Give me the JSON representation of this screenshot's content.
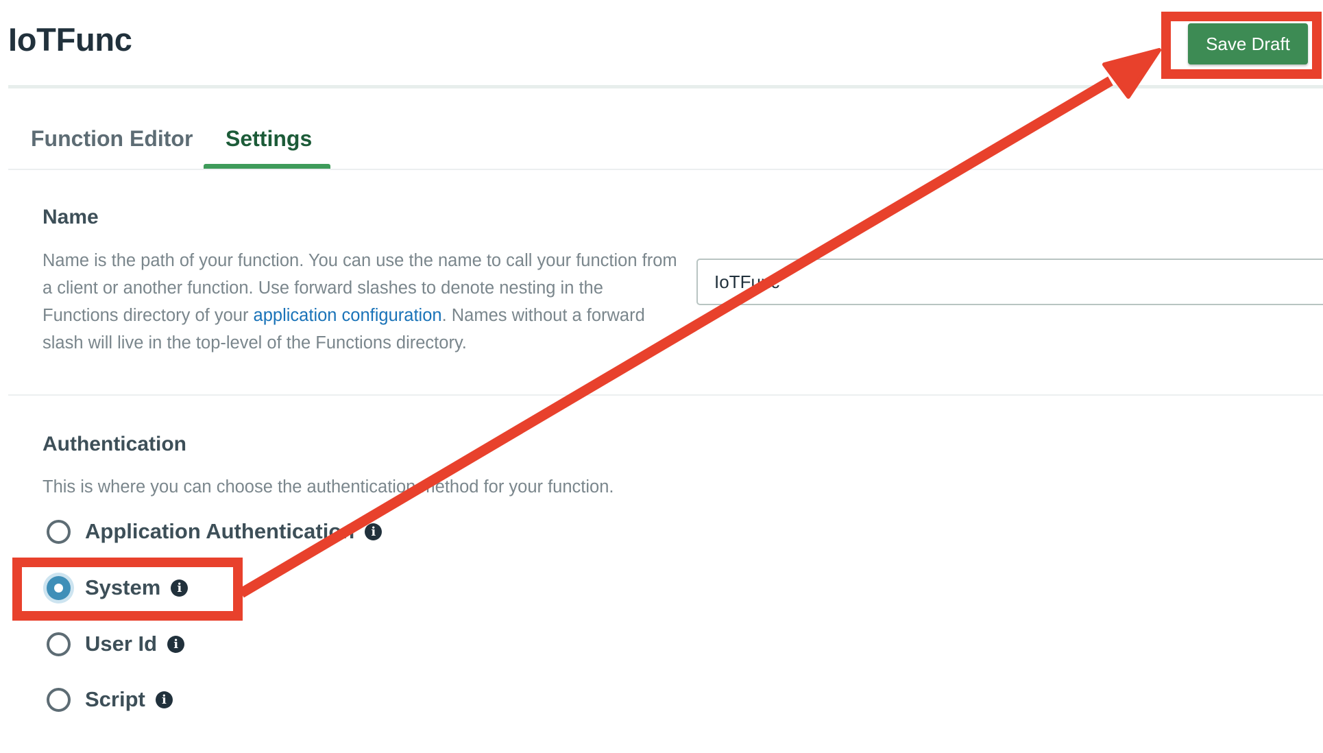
{
  "header": {
    "title": "IoTFunc",
    "save_label": "Save Draft"
  },
  "tabs": [
    {
      "label": "Function Editor",
      "active": false
    },
    {
      "label": "Settings",
      "active": true
    }
  ],
  "name_section": {
    "heading": "Name",
    "desc_before": "Name is the path of your function. You can use the name to call your function from a client or another function. Use forward slashes to denote nesting in the Functions directory of your ",
    "desc_link": "application configuration",
    "desc_after": ". Names without a forward slash will live in the top-level of the Functions directory.",
    "input_value": "IoTFunc"
  },
  "auth_section": {
    "heading": "Authentication",
    "desc": "This is where you can choose the authentication method for your function.",
    "options": [
      {
        "label": "Application Authentication",
        "checked": false
      },
      {
        "label": "System",
        "checked": true
      },
      {
        "label": "User Id",
        "checked": false
      },
      {
        "label": "Script",
        "checked": false
      }
    ],
    "info_glyph": "i"
  },
  "colors": {
    "accent_green": "#3d8b54",
    "active_tab": "#1c5b38",
    "link_blue": "#1a73b8",
    "radio_selected": "#3f8fb8",
    "annotation_red": "#e8412c"
  },
  "icons": {
    "info": "info-icon",
    "annotation_arrow": "arrow-icon"
  }
}
